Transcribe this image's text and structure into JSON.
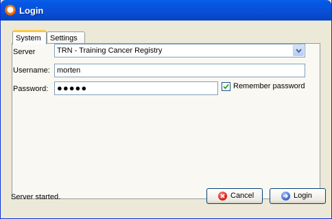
{
  "window": {
    "title": "Login"
  },
  "tabs": [
    {
      "label": "System",
      "active": true
    },
    {
      "label": "Settings",
      "active": false
    }
  ],
  "form": {
    "server_label": "Server",
    "server_value": "TRN - Training Cancer Registry",
    "username_label": "Username:",
    "username_value": "morten",
    "password_label": "Password:",
    "password_masked": "●●●●●",
    "remember_label": "Remember password",
    "remember_checked": true
  },
  "status": {
    "text": "Server started."
  },
  "buttons": {
    "cancel_label": "Cancel",
    "login_label": "Login"
  },
  "icons": {
    "app": "app-logo-icon",
    "cancel": "cancel-icon",
    "login": "login-arrow-icon",
    "dropdown": "chevron-down-icon",
    "checkbox": "checkmark-icon"
  },
  "colors": {
    "titlebar": "#0a4fd6",
    "window_bg": "#ece9d8",
    "tab_highlight": "#ffc83c"
  }
}
